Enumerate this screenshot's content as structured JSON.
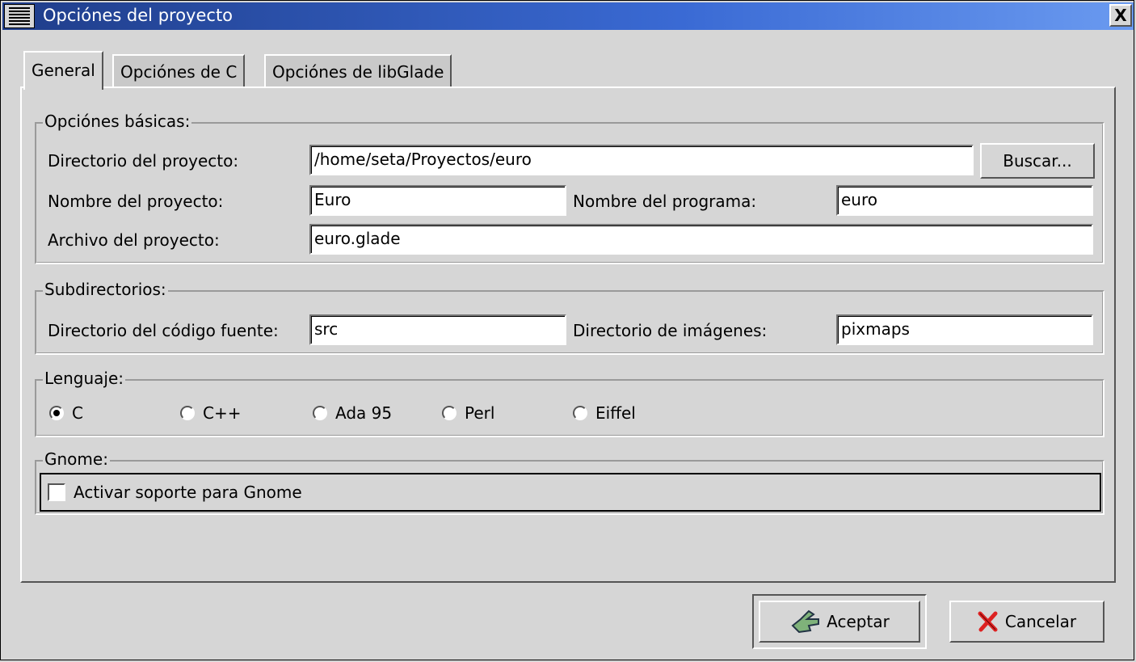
{
  "window": {
    "title": "Opciónes del proyecto",
    "close_label": "X"
  },
  "tabs": [
    {
      "label": "General",
      "active": true
    },
    {
      "label": "Opciónes de C",
      "active": false
    },
    {
      "label": "Opciónes de libGlade",
      "active": false
    }
  ],
  "basic": {
    "title": "Opciónes básicas:",
    "dir_label": "Directorio del proyecto:",
    "dir_value": "/home/seta/Proyectos/euro",
    "browse_label": "Buscar...",
    "name_label": "Nombre del proyecto:",
    "name_value": "Euro",
    "program_label": "Nombre del programa:",
    "program_value": "euro",
    "file_label": "Archivo del proyecto:",
    "file_value": "euro.glade"
  },
  "subdirs": {
    "title": "Subdirectorios:",
    "src_label": "Directorio del código fuente:",
    "src_value": "src",
    "pix_label": "Directorio de imágenes:",
    "pix_value": "pixmaps"
  },
  "language": {
    "title": "Lenguaje:",
    "options": [
      "C",
      "C++",
      "Ada 95",
      "Perl",
      "Eiffel"
    ],
    "selected": "C"
  },
  "gnome": {
    "title": "Gnome:",
    "checkbox_label": "Activar soporte para Gnome",
    "checked": false
  },
  "buttons": {
    "ok": "Aceptar",
    "cancel": "Cancelar"
  },
  "icons": {
    "ok": "hand-pointing-icon",
    "cancel": "red-x-icon"
  }
}
